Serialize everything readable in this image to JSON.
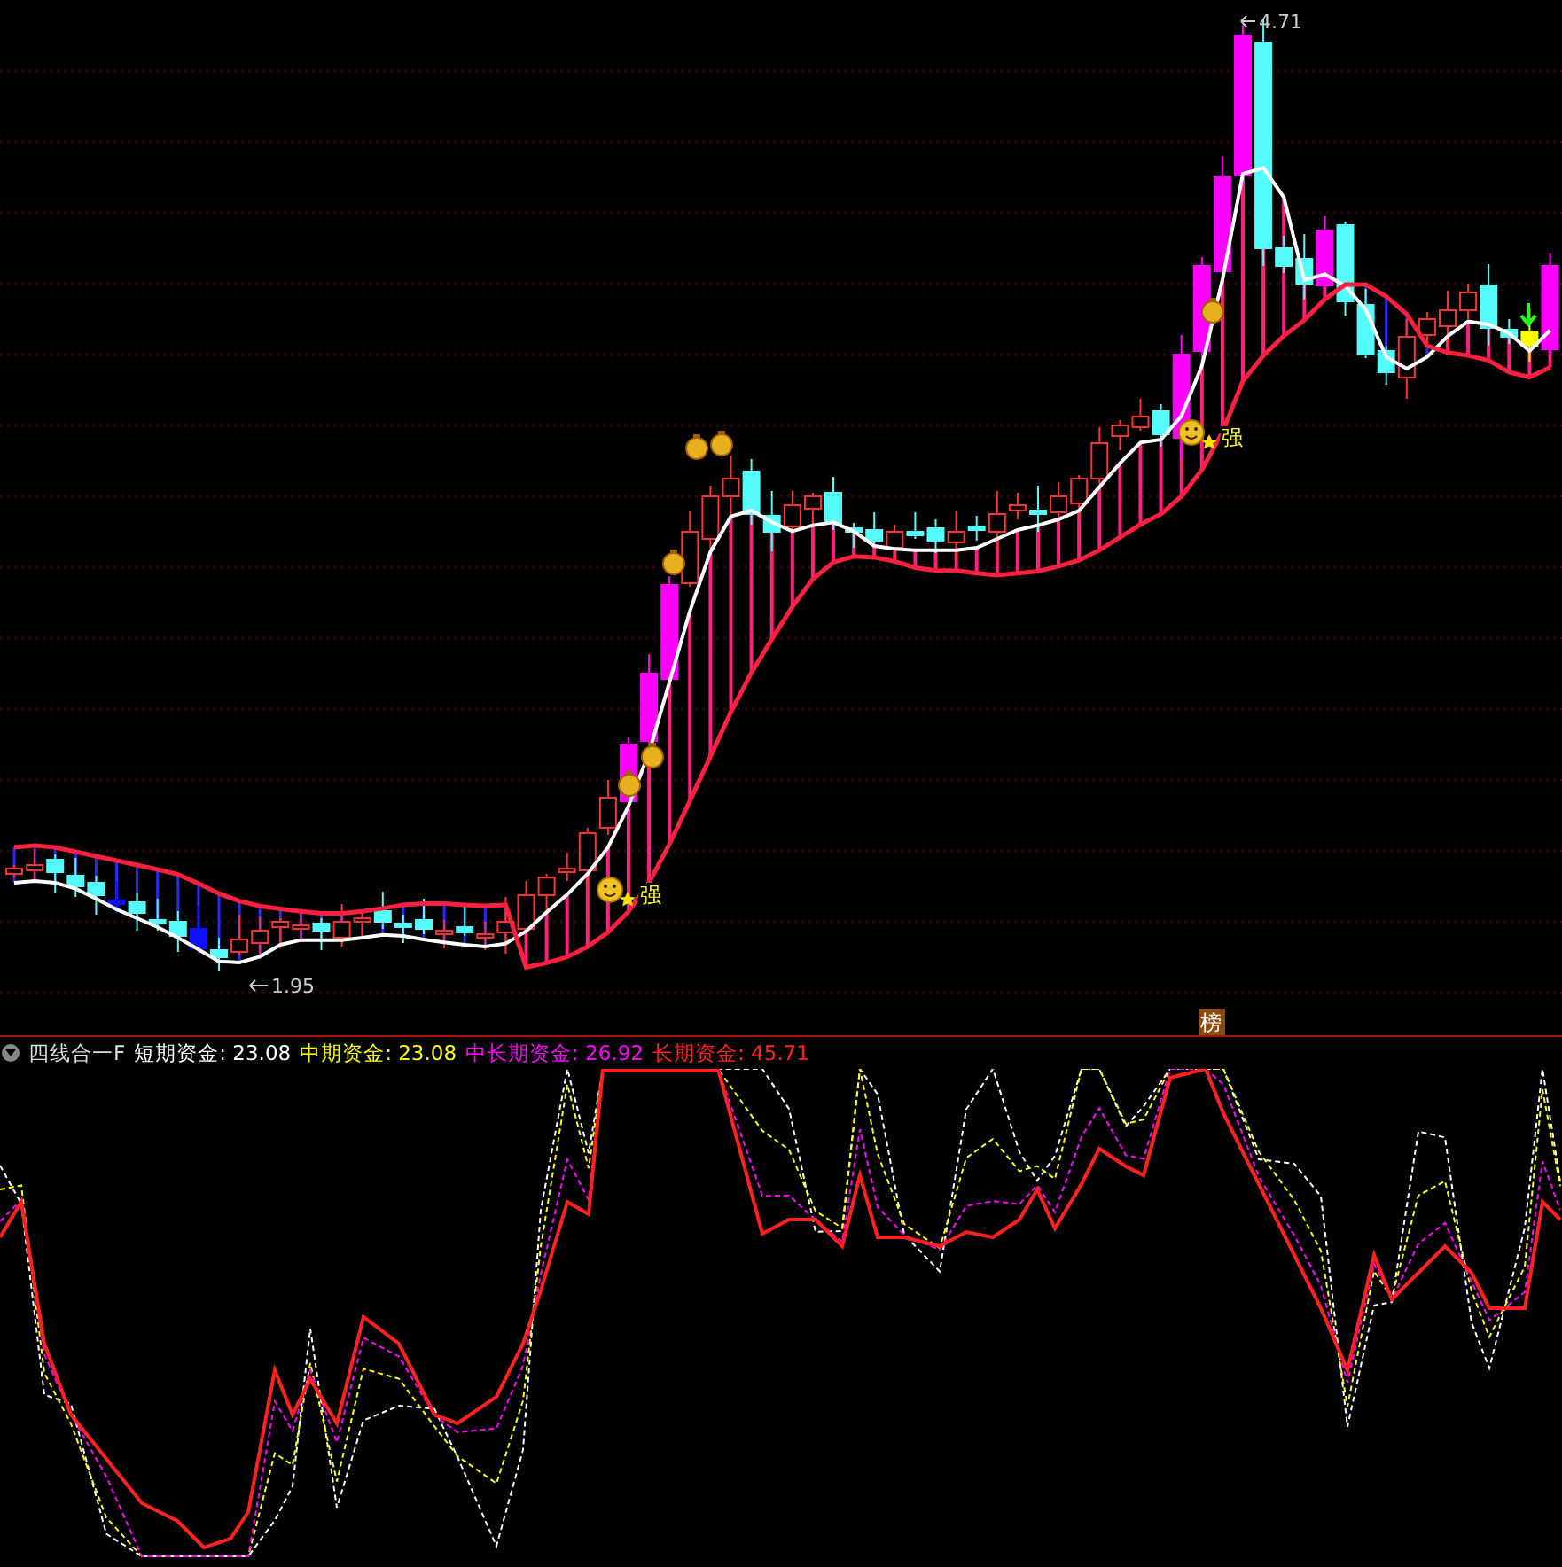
{
  "price_chart": {
    "high_label": "4.71",
    "low_label": "1.95",
    "signals": [
      {
        "kind": "strong",
        "text": "强"
      },
      {
        "kind": "strong",
        "text": "强"
      }
    ],
    "badge": "榜"
  },
  "indicator": {
    "name": "四线合一F",
    "lines": [
      {
        "label": "短期资金: 23.08",
        "color": "#ffffff"
      },
      {
        "label": "中期资金: 23.08",
        "color": "#ffff00"
      },
      {
        "label": "中长期资金: 26.92",
        "color": "#ff00ff"
      },
      {
        "label": "长期资金: 45.71",
        "color": "#ff2020"
      }
    ]
  }
}
